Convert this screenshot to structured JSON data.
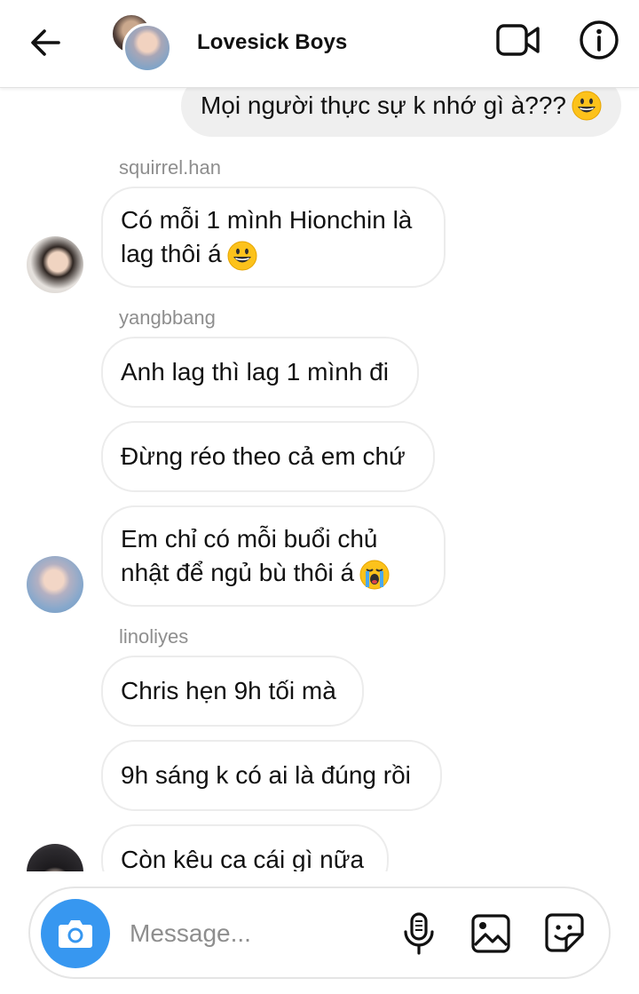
{
  "header": {
    "title": "Lovesick Boys",
    "back_icon": "arrow-left-icon",
    "video_icon": "video-camera-icon",
    "info_icon": "info-icon"
  },
  "messages": {
    "outgoing": [
      {
        "text": "Mọi người thực sự k nhớ gì à???",
        "emoji": "grinning-face-emoji"
      }
    ],
    "groups": [
      {
        "sender": "squirrel.han",
        "bubbles": [
          {
            "line1": "Có mỗi 1 mình Hionchin là",
            "line2": "lag thôi á",
            "emoji": "grinning-face-emoji"
          }
        ]
      },
      {
        "sender": "yangbbang",
        "bubbles": [
          {
            "text": "Anh lag thì lag 1 mình đi"
          },
          {
            "text": "Đừng réo theo cả em chứ"
          },
          {
            "line1": "Em chỉ có mỗi buổi chủ",
            "line2": "nhật để ngủ bù thôi á",
            "emoji": "loudly-crying-face-emoji"
          }
        ]
      },
      {
        "sender": "linoliyes",
        "bubbles": [
          {
            "text": "Chris hẹn 9h tối mà"
          },
          {
            "text": "9h sáng k có ai là đúng rồi"
          },
          {
            "text": "Còn kêu ca cái gì nữa"
          }
        ]
      }
    ]
  },
  "composer": {
    "placeholder": "Message...",
    "camera_icon": "camera-icon",
    "mic_icon": "microphone-icon",
    "gallery_icon": "image-icon",
    "sticker_icon": "sticker-icon"
  },
  "colors": {
    "accent": "#3797f0",
    "outgoing_bubble": "#efefef",
    "incoming_border": "#ececec",
    "sender_text": "#8e8e8e"
  }
}
